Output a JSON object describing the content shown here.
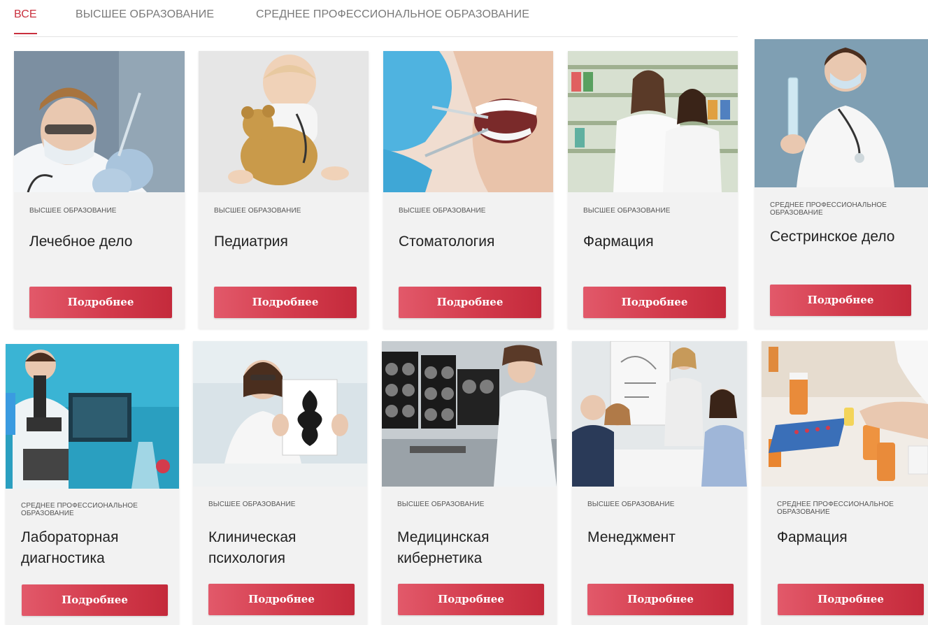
{
  "tabs": [
    {
      "label": "ВСЕ",
      "active": true
    },
    {
      "label": "ВЫСШЕЕ ОБРАЗОВАНИЕ",
      "active": false
    },
    {
      "label": "СРЕДНЕЕ ПРОФЕССИОНАЛЬНОЕ ОБРАЗОВАНИЕ",
      "active": false
    }
  ],
  "cards": [
    {
      "category": "ВЫСШЕЕ ОБРАЗОВАНИЕ",
      "title": "Лечебное дело",
      "button": "Подробнее",
      "image": "doctor-with-syringe-photo"
    },
    {
      "category": "ВЫСШЕЕ ОБРАЗОВАНИЕ",
      "title": "Педиатрия",
      "button": "Подробнее",
      "image": "baby-with-teddy-bear-photo"
    },
    {
      "category": "ВЫСШЕЕ ОБРАЗОВАНИЕ",
      "title": "Стоматология",
      "button": "Подробнее",
      "image": "dental-examination-photo"
    },
    {
      "category": "ВЫСШЕЕ ОБРАЗОВАНИЕ",
      "title": "Фармация",
      "button": "Подробнее",
      "image": "pharmacists-photo"
    },
    {
      "category": "СРЕДНЕЕ ПРОФЕССИОНАЛЬНОЕ ОБРАЗОВАНИЕ",
      "title": "Сестринское дело",
      "button": "Подробнее",
      "image": "nurse-with-syringe-photo"
    },
    {
      "category": "СРЕДНЕЕ ПРОФЕССИОНАЛЬНОЕ ОБРАЗОВАНИЕ",
      "title": "Лабораторная диагностика",
      "button": "Подробнее",
      "image": "microscope-lab-photo"
    },
    {
      "category": "ВЫСШЕЕ ОБРАЗОВАНИЕ",
      "title": "Клиническая психология",
      "button": "Подробнее",
      "image": "psychologist-inkblot-photo"
    },
    {
      "category": "ВЫСШЕЕ ОБРАЗОВАНИЕ",
      "title": "Медицинская кибернетика",
      "button": "Подробнее",
      "image": "ct-scan-monitors-photo"
    },
    {
      "category": "ВЫСШЕЕ ОБРАЗОВАНИЕ",
      "title": "Менеджмент",
      "button": "Подробнее",
      "image": "business-meeting-photo"
    },
    {
      "category": "СРЕДНЕЕ ПРОФЕССИОНАЛЬНОЕ ОБРАЗОВАНИЕ",
      "title": "Фармация",
      "button": "Подробнее",
      "image": "pills-bottles-photo"
    }
  ],
  "colors": {
    "accent": "#c9303e",
    "button_start": "#e2596a",
    "button_end": "#c42a3b",
    "card_background": "#f2f2f2"
  }
}
